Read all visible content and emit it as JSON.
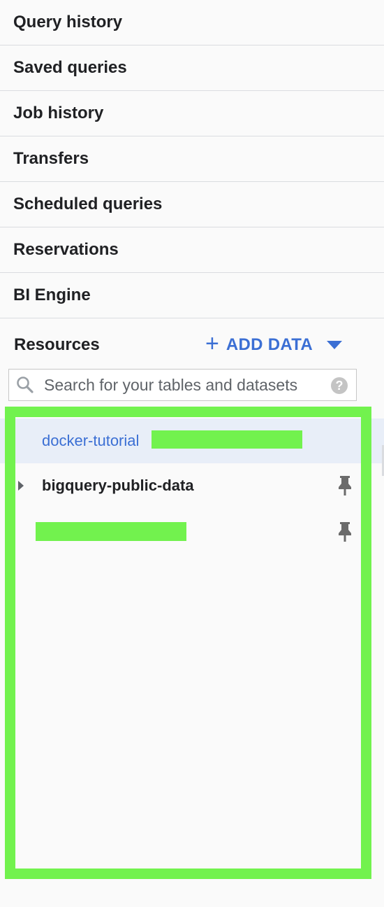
{
  "nav": {
    "items": [
      {
        "label": "Query history"
      },
      {
        "label": "Saved queries"
      },
      {
        "label": "Job history"
      },
      {
        "label": "Transfers"
      },
      {
        "label": "Scheduled queries"
      },
      {
        "label": "Reservations"
      },
      {
        "label": "BI Engine"
      }
    ]
  },
  "resources": {
    "title": "Resources",
    "add_data_label": "ADD DATA",
    "add_data_icon": "plus-icon",
    "dropdown_icon": "caret-down-icon",
    "search": {
      "placeholder": "Search for your tables and datasets",
      "value": "",
      "icon": "search-icon",
      "help_icon": "help-icon",
      "help_glyph": "?"
    },
    "projects": [
      {
        "label": "docker-tutorial",
        "selected": true,
        "redacted_suffix": true,
        "color": "#3b6fd4"
      },
      {
        "label": "bigquery-public-data",
        "expandable": true,
        "pinned": true
      },
      {
        "label": "",
        "redacted": true,
        "pinned": true
      }
    ]
  },
  "colors": {
    "accent": "#3b6fd4",
    "highlight": "#72f24e",
    "selected_bg": "#e8eef8",
    "divider": "#dadce0"
  }
}
